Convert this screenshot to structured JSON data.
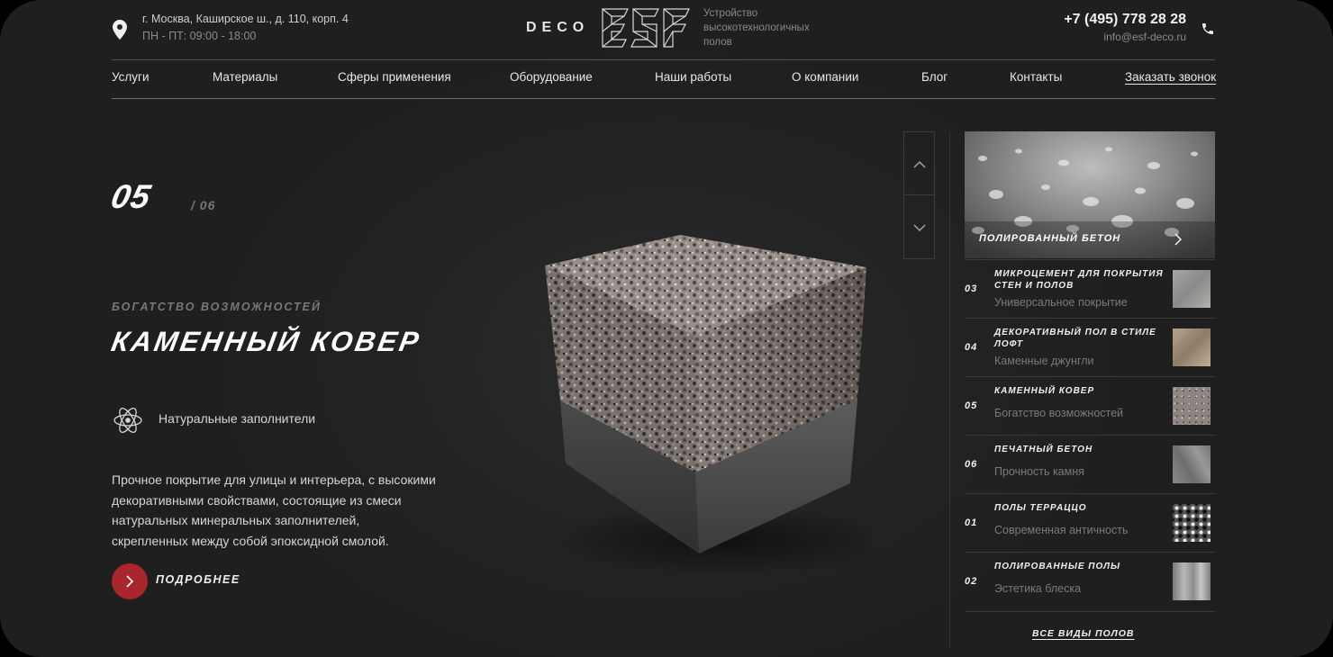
{
  "header": {
    "address": "г. Москва, Каширское ш., д. 110, корп. 4",
    "hours": "ПН - ПТ: 09:00 - 18:00",
    "logo_prefix": "DECO",
    "logo_mark": "ESF",
    "logo_description": "Устройство высокотехнологичных полов",
    "phone": "+7 (495) 778 28 28",
    "email": "info@esf-deco.ru",
    "icons": [
      "location-pin-icon",
      "phone-icon"
    ]
  },
  "nav": {
    "items": [
      "Услуги",
      "Материалы",
      "Сферы применения",
      "Оборудование",
      "Наши работы",
      "О компании",
      "Блог",
      "Контакты"
    ],
    "cta": "Заказать звонок"
  },
  "hero": {
    "current": "05",
    "separator": "/",
    "total": "06",
    "subtitle": "Богатство возможностей",
    "title": "Каменный ковер",
    "feature": "Натуральные заполнители",
    "feature_icon": "atom-icon",
    "description": "Прочное покрытие для улицы и интерьера, с высокими декоративными свойствами, состоящие из смеси натуральных минеральных заполнителей, скрепленных между собой эпоксидной смолой.",
    "more_label": "Подробнее"
  },
  "slider": {
    "featured_label": "Полированный бетон",
    "items": [
      {
        "num": "03",
        "name": "Микроцемент для покрытия стен и полов",
        "sub": "Универсальное покрытие"
      },
      {
        "num": "04",
        "name": "Декоративный пол в стиле лофт",
        "sub": "Каменные джунгли"
      },
      {
        "num": "05",
        "name": "Каменный ковер",
        "sub": "Богатство возможностей"
      },
      {
        "num": "06",
        "name": "Печатный бетон",
        "sub": "Прочность камня"
      },
      {
        "num": "01",
        "name": "Полы терраццо",
        "sub": "Современная античность"
      },
      {
        "num": "02",
        "name": "Полированные полы",
        "sub": "Эстетика блеска"
      }
    ],
    "all_link": "Все виды полов"
  },
  "colors": {
    "accent": "#a8262c",
    "background": "#232323"
  }
}
